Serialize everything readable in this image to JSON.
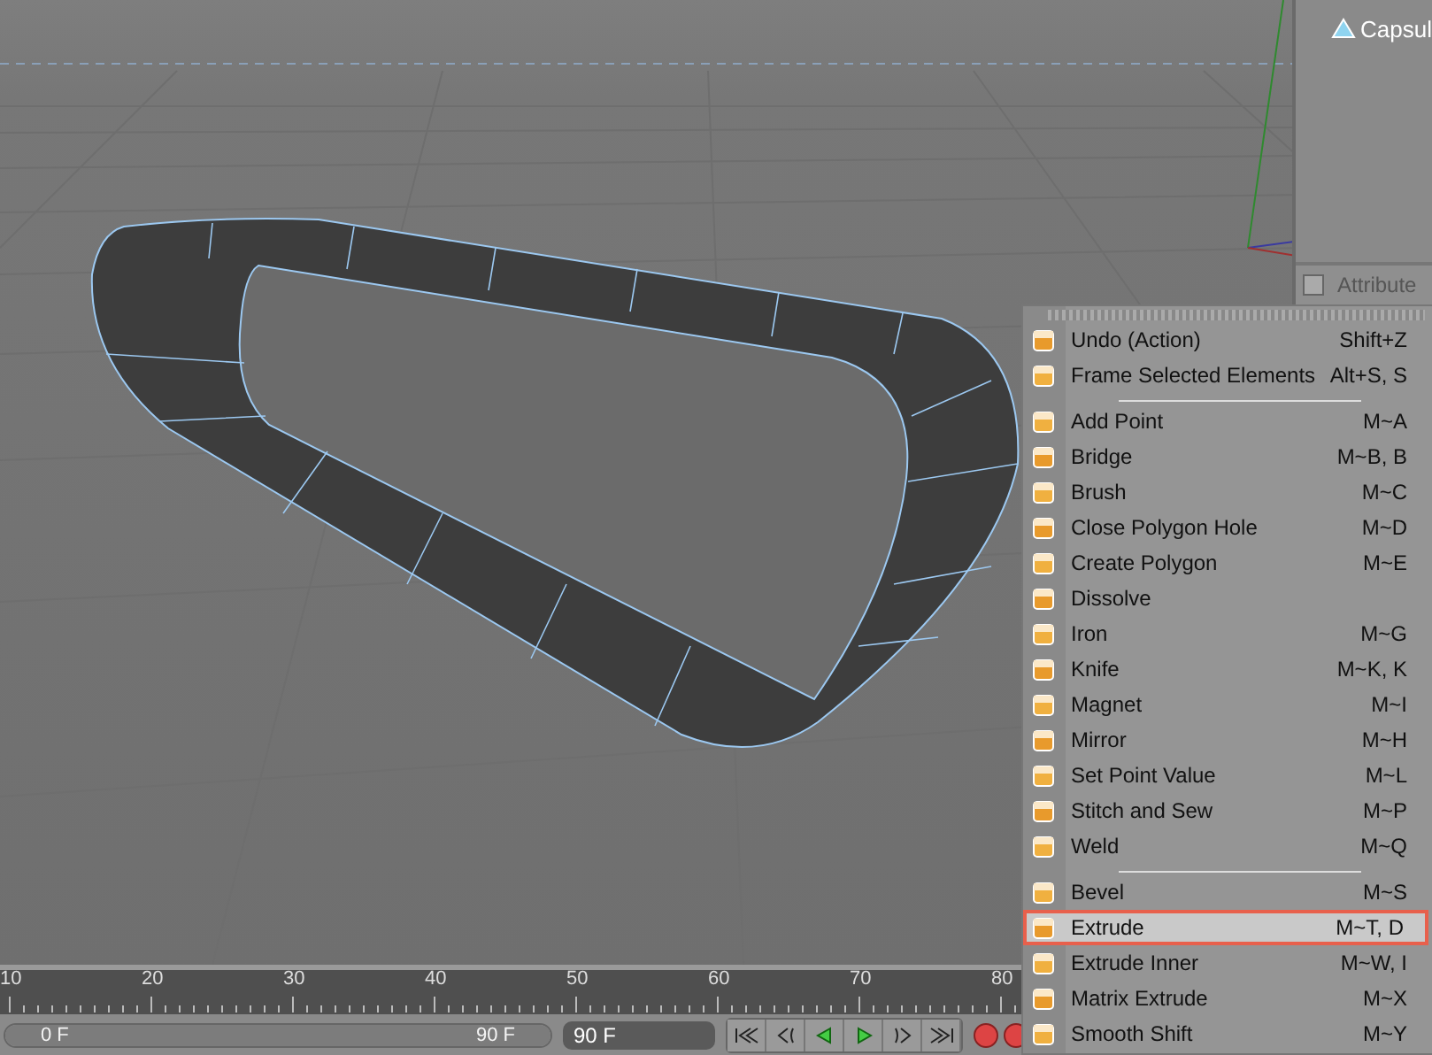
{
  "object_manager": {
    "items": [
      {
        "label": "Capsul",
        "selected": false
      }
    ]
  },
  "attributes": {
    "label": "Attribute",
    "checked": false
  },
  "timeline": {
    "ticks": [
      "10",
      "20",
      "30",
      "40",
      "50",
      "60",
      "70",
      "80"
    ],
    "range": {
      "start": "0 F",
      "end": "90 F",
      "level": 1
    },
    "end_frame": "90 F"
  },
  "context_menu": {
    "items": [
      {
        "kind": "item",
        "label": "Undo (Action)",
        "shortcut": "Shift+Z",
        "selected": false
      },
      {
        "kind": "item",
        "label": "Frame Selected Elements",
        "shortcut": "Alt+S, S",
        "selected": false
      },
      {
        "kind": "separator"
      },
      {
        "kind": "item",
        "label": "Add Point",
        "shortcut": "M~A",
        "selected": false
      },
      {
        "kind": "item",
        "label": "Bridge",
        "shortcut": "M~B, B",
        "selected": false
      },
      {
        "kind": "item",
        "label": "Brush",
        "shortcut": "M~C",
        "selected": false
      },
      {
        "kind": "item",
        "label": "Close Polygon Hole",
        "shortcut": "M~D",
        "selected": false
      },
      {
        "kind": "item",
        "label": "Create Polygon",
        "shortcut": "M~E",
        "selected": false
      },
      {
        "kind": "item",
        "label": "Dissolve",
        "selected": false
      },
      {
        "kind": "item",
        "label": "Iron",
        "shortcut": "M~G",
        "selected": false
      },
      {
        "kind": "item",
        "label": "Knife",
        "shortcut": "M~K, K",
        "selected": false
      },
      {
        "kind": "item",
        "label": "Magnet",
        "shortcut": "M~I",
        "selected": false
      },
      {
        "kind": "item",
        "label": "Mirror",
        "shortcut": "M~H",
        "selected": false
      },
      {
        "kind": "item",
        "label": "Set Point Value",
        "shortcut": "M~L",
        "selected": false
      },
      {
        "kind": "item",
        "label": "Stitch and Sew",
        "shortcut": "M~P",
        "selected": false
      },
      {
        "kind": "item",
        "label": "Weld",
        "shortcut": "M~Q",
        "selected": false
      },
      {
        "kind": "separator"
      },
      {
        "kind": "item",
        "label": "Bevel",
        "shortcut": "M~S",
        "selected": false
      },
      {
        "kind": "item",
        "label": "Extrude",
        "shortcut": "M~T, D",
        "selected": true
      },
      {
        "kind": "item",
        "label": "Extrude Inner",
        "shortcut": "M~W, I",
        "selected": false
      },
      {
        "kind": "item",
        "label": "Matrix Extrude",
        "shortcut": "M~X",
        "selected": false
      },
      {
        "kind": "item",
        "label": "Smooth Shift",
        "shortcut": "M~Y",
        "selected": false
      }
    ]
  }
}
